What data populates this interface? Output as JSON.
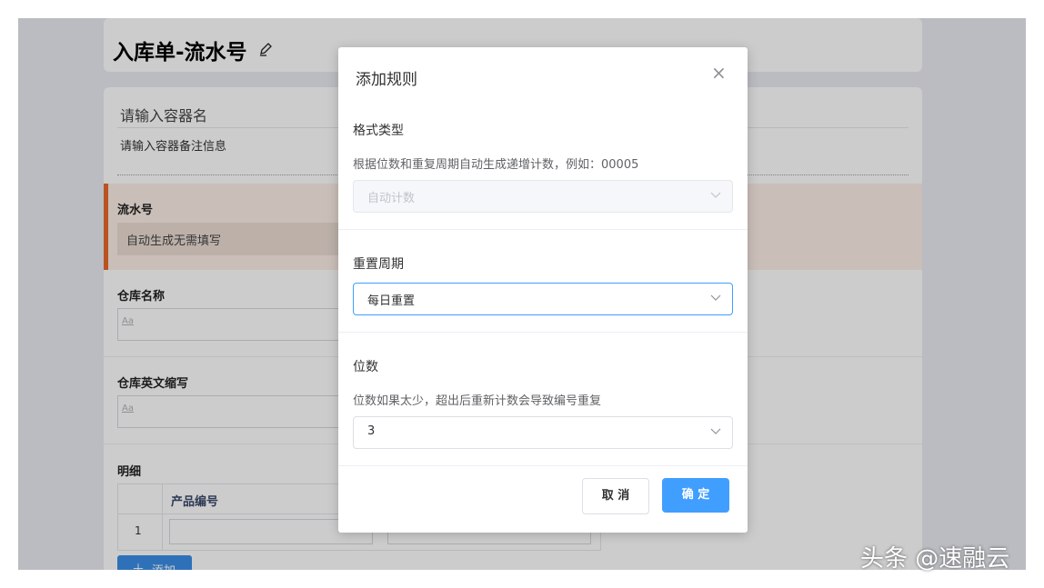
{
  "page": {
    "title": "入库单-流水号",
    "container_name_placeholder": "请输入容器名",
    "container_note_placeholder": "请输入容器备注信息",
    "serial": {
      "label": "流水号",
      "value": "自动生成无需填写"
    },
    "fields": [
      {
        "label": "仓库名称",
        "placeholder": "Aa"
      },
      {
        "label": "仓库英文缩写",
        "placeholder": "Aa"
      }
    ],
    "detail": {
      "label": "明细",
      "columns": [
        "产品编号"
      ],
      "rows": [
        {
          "index": "1"
        }
      ],
      "add_label": "添加",
      "add_icon": "plus-icon"
    }
  },
  "modal": {
    "title": "添加规则",
    "close_icon": "close-icon",
    "format": {
      "label": "格式类型",
      "desc": "根据位数和重复周期自动生成递增计数，例如：00005",
      "value": "自动计数"
    },
    "reset": {
      "label": "重置周期",
      "value": "每日重置"
    },
    "digits": {
      "label": "位数",
      "desc": "位数如果太少，超出后重新计数会导致编号重复",
      "value": "3"
    },
    "cancel_label": "取 消",
    "ok_label": "确 定"
  },
  "watermark": "头条 @速融云",
  "colors": {
    "primary": "#409eff",
    "accent": "#e8682b",
    "add_button": "#3a8ee6"
  }
}
